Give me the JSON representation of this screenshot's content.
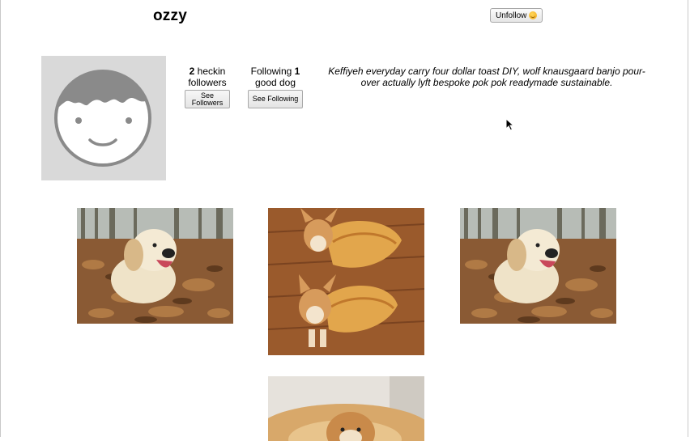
{
  "profile": {
    "username": "ozzy",
    "unfollow_label": "Unfollow",
    "followers": {
      "count": "2",
      "label": "heckin followers",
      "button_label": "See Followers"
    },
    "following": {
      "prefix": "Following",
      "count": "1",
      "label": "good dog",
      "button_label": "See Following"
    },
    "bio": "Keffiyeh everyday carry four dollar toast DIY, wolf knausgaard banjo pour-over actually lyft bespoke pok pok readymade sustainable."
  },
  "icons": {
    "avatar": "default-face-avatar-icon",
    "unfollow_emoji": "smiling-face-icon",
    "cursor": "mouse-pointer-icon"
  },
  "posts": [
    {
      "subject": "golden retriever in autumn leaves"
    },
    {
      "subject": "two corgis in taco costumes"
    },
    {
      "subject": "golden retriever in autumn leaves"
    },
    {
      "subject": "dog in fluffy bed"
    }
  ],
  "colors": {
    "avatar_bg": "#d9d9d9",
    "avatar_line": "#8a8a8a"
  }
}
